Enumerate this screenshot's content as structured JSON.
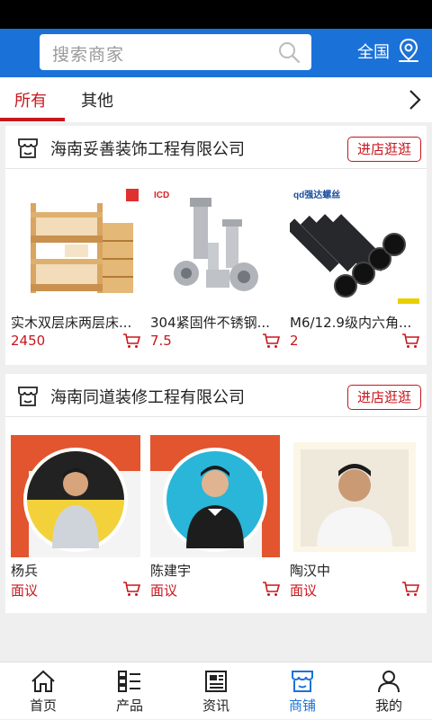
{
  "header": {
    "search_placeholder": "搜索商家",
    "region": "全国"
  },
  "tabs": [
    {
      "label": "所有",
      "active": true
    },
    {
      "label": "其他",
      "active": false
    }
  ],
  "shops": [
    {
      "name": "海南妥善装饰工程有限公司",
      "enter_label": "进店逛逛",
      "items": [
        {
          "title": "实木双层床两层床...",
          "price": "2450"
        },
        {
          "title": "304紧固件不锈钢...",
          "price": "7.5"
        },
        {
          "title": "M6/12.9级内六角...",
          "price": "2"
        }
      ]
    },
    {
      "name": "海南同道装修工程有限公司",
      "enter_label": "进店逛逛",
      "items": [
        {
          "title": "杨兵",
          "price": "面议"
        },
        {
          "title": "陈建宇",
          "price": "面议"
        },
        {
          "title": "陶汉中",
          "price": "面议"
        }
      ]
    }
  ],
  "image_text": {
    "brand_bolt": "ICD",
    "brand_screw": "qd强达螺丝"
  },
  "bottom_nav": [
    {
      "label": "首页",
      "icon": "home-icon",
      "active": false
    },
    {
      "label": "产品",
      "icon": "product-list-icon",
      "active": false
    },
    {
      "label": "资讯",
      "icon": "news-icon",
      "active": false
    },
    {
      "label": "商铺",
      "icon": "shop-icon",
      "active": true
    },
    {
      "label": "我的",
      "icon": "user-icon",
      "active": false
    }
  ],
  "colors": {
    "brand_blue": "#1a72d9",
    "accent_red": "#c8161d"
  }
}
